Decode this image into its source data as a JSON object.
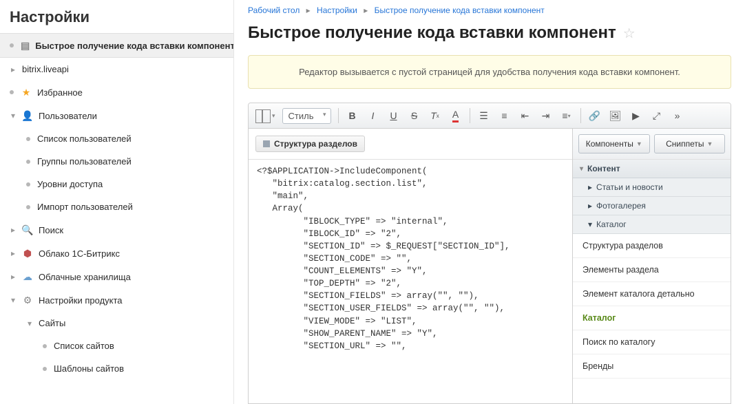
{
  "sidebar": {
    "title": "Настройки",
    "items": [
      {
        "label": "Быстрое получение кода вставки компонент"
      },
      {
        "label": "bitrix.liveapi"
      },
      {
        "label": "Избранное"
      },
      {
        "label": "Пользователи"
      },
      {
        "label": "Список пользователей"
      },
      {
        "label": "Группы пользователей"
      },
      {
        "label": "Уровни доступа"
      },
      {
        "label": "Импорт пользователей"
      },
      {
        "label": "Поиск"
      },
      {
        "label": "Облако 1С-Битрикс"
      },
      {
        "label": "Облачные хранилища"
      },
      {
        "label": "Настройки продукта"
      },
      {
        "label": "Сайты"
      },
      {
        "label": "Список сайтов"
      },
      {
        "label": "Шаблоны сайтов"
      }
    ]
  },
  "breadcrumb": {
    "parts": [
      "Рабочий стол",
      "Настройки",
      "Быстрое получение кода вставки компонент"
    ]
  },
  "page": {
    "title": "Быстрое получение кода вставки компонент"
  },
  "notice": {
    "text": "Редактор вызывается с пустой страницей для удобства получения кода вставки компонент."
  },
  "toolbar": {
    "style_label": "Стиль"
  },
  "canvas": {
    "struct_button": "Структура разделов"
  },
  "code": "<?$APPLICATION->IncludeComponent(\n   \"bitrix:catalog.section.list\",\n   \"main\",\n   Array(\n         \"IBLOCK_TYPE\" => \"internal\",\n         \"IBLOCK_ID\" => \"2\",\n         \"SECTION_ID\" => $_REQUEST[\"SECTION_ID\"],\n         \"SECTION_CODE\" => \"\",\n         \"COUNT_ELEMENTS\" => \"Y\",\n         \"TOP_DEPTH\" => \"2\",\n         \"SECTION_FIELDS\" => array(\"\", \"\"),\n         \"SECTION_USER_FIELDS\" => array(\"\", \"\"),\n         \"VIEW_MODE\" => \"LIST\",\n         \"SHOW_PARENT_NAME\" => \"Y\",\n         \"SECTION_URL\" => \"\",",
  "side_panel": {
    "tabs": {
      "components": "Компоненты",
      "snippets": "Сниппеты"
    },
    "groups": {
      "content": "Контент",
      "articles": "Статьи и новости",
      "gallery": "Фотогалерея",
      "catalog": "Каталог"
    },
    "catalog_items": [
      {
        "label": "Структура разделов"
      },
      {
        "label": "Элементы раздела"
      },
      {
        "label": "Элемент каталога детально"
      },
      {
        "label": "Каталог",
        "selected": true
      },
      {
        "label": "Поиск по каталогу"
      },
      {
        "label": "Бренды"
      }
    ]
  }
}
